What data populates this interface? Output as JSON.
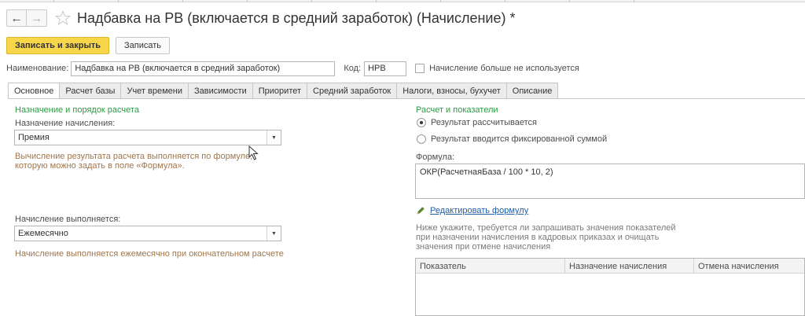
{
  "window": {
    "title": "Надбавка на РВ (включается в средний заработок) (Начисление) *"
  },
  "nav": {
    "back_icon": "←",
    "forward_icon": "→",
    "favorite_icon": "star-icon"
  },
  "toolbar": {
    "save_close_label": "Записать и закрыть",
    "save_label": "Записать"
  },
  "header": {
    "name_label": "Наименование:",
    "name_value": "Надбавка на РВ (включается в средний заработок)",
    "code_label": "Код:",
    "code_value": "НРВ",
    "unused_label": "Начисление больше не используется",
    "unused_checked": false
  },
  "tabs": [
    {
      "label": "Основное",
      "active": true
    },
    {
      "label": "Расчет базы",
      "active": false
    },
    {
      "label": "Учет времени",
      "active": false
    },
    {
      "label": "Зависимости",
      "active": false
    },
    {
      "label": "Приоритет",
      "active": false
    },
    {
      "label": "Средний заработок",
      "active": false
    },
    {
      "label": "Налоги, взносы, бухучет",
      "active": false
    },
    {
      "label": "Описание",
      "active": false
    }
  ],
  "left": {
    "section_title": "Назначение и порядок расчета",
    "purpose_label": "Назначение начисления:",
    "purpose_value": "Премия",
    "purpose_note_line1": "Вычисление результата расчета выполняется по формуле,",
    "purpose_note_line2": "которую можно задать в поле «Формула».",
    "periodicity_label": "Начисление выполняется:",
    "periodicity_value": "Ежемесячно",
    "periodicity_note": "Начисление выполняется ежемесячно при окончательном расчете"
  },
  "right": {
    "section_title": "Расчет и показатели",
    "radio_calculated": "Результат рассчитывается",
    "radio_fixed": "Результат вводится фиксированной суммой",
    "selected_radio": "calculated",
    "formula_label": "Формула:",
    "formula_value": "ОКР(РасчетнаяБаза / 100 * 10, 2)",
    "edit_formula_link": "Редактировать формулу",
    "indicators_note_line1": "Ниже укажите, требуется ли запрашивать значения показателей",
    "indicators_note_line2": "при назначении начисления в кадровых приказах и очищать",
    "indicators_note_line3": "значения при отмене начисления",
    "grid_columns": [
      "Показатель",
      "Назначение начисления",
      "Отмена начисления"
    ]
  },
  "colors": {
    "accent_button": "#f7d64a",
    "section_title": "#2c9b42",
    "note_text": "#a0764a",
    "link": "#1f5fa8"
  }
}
